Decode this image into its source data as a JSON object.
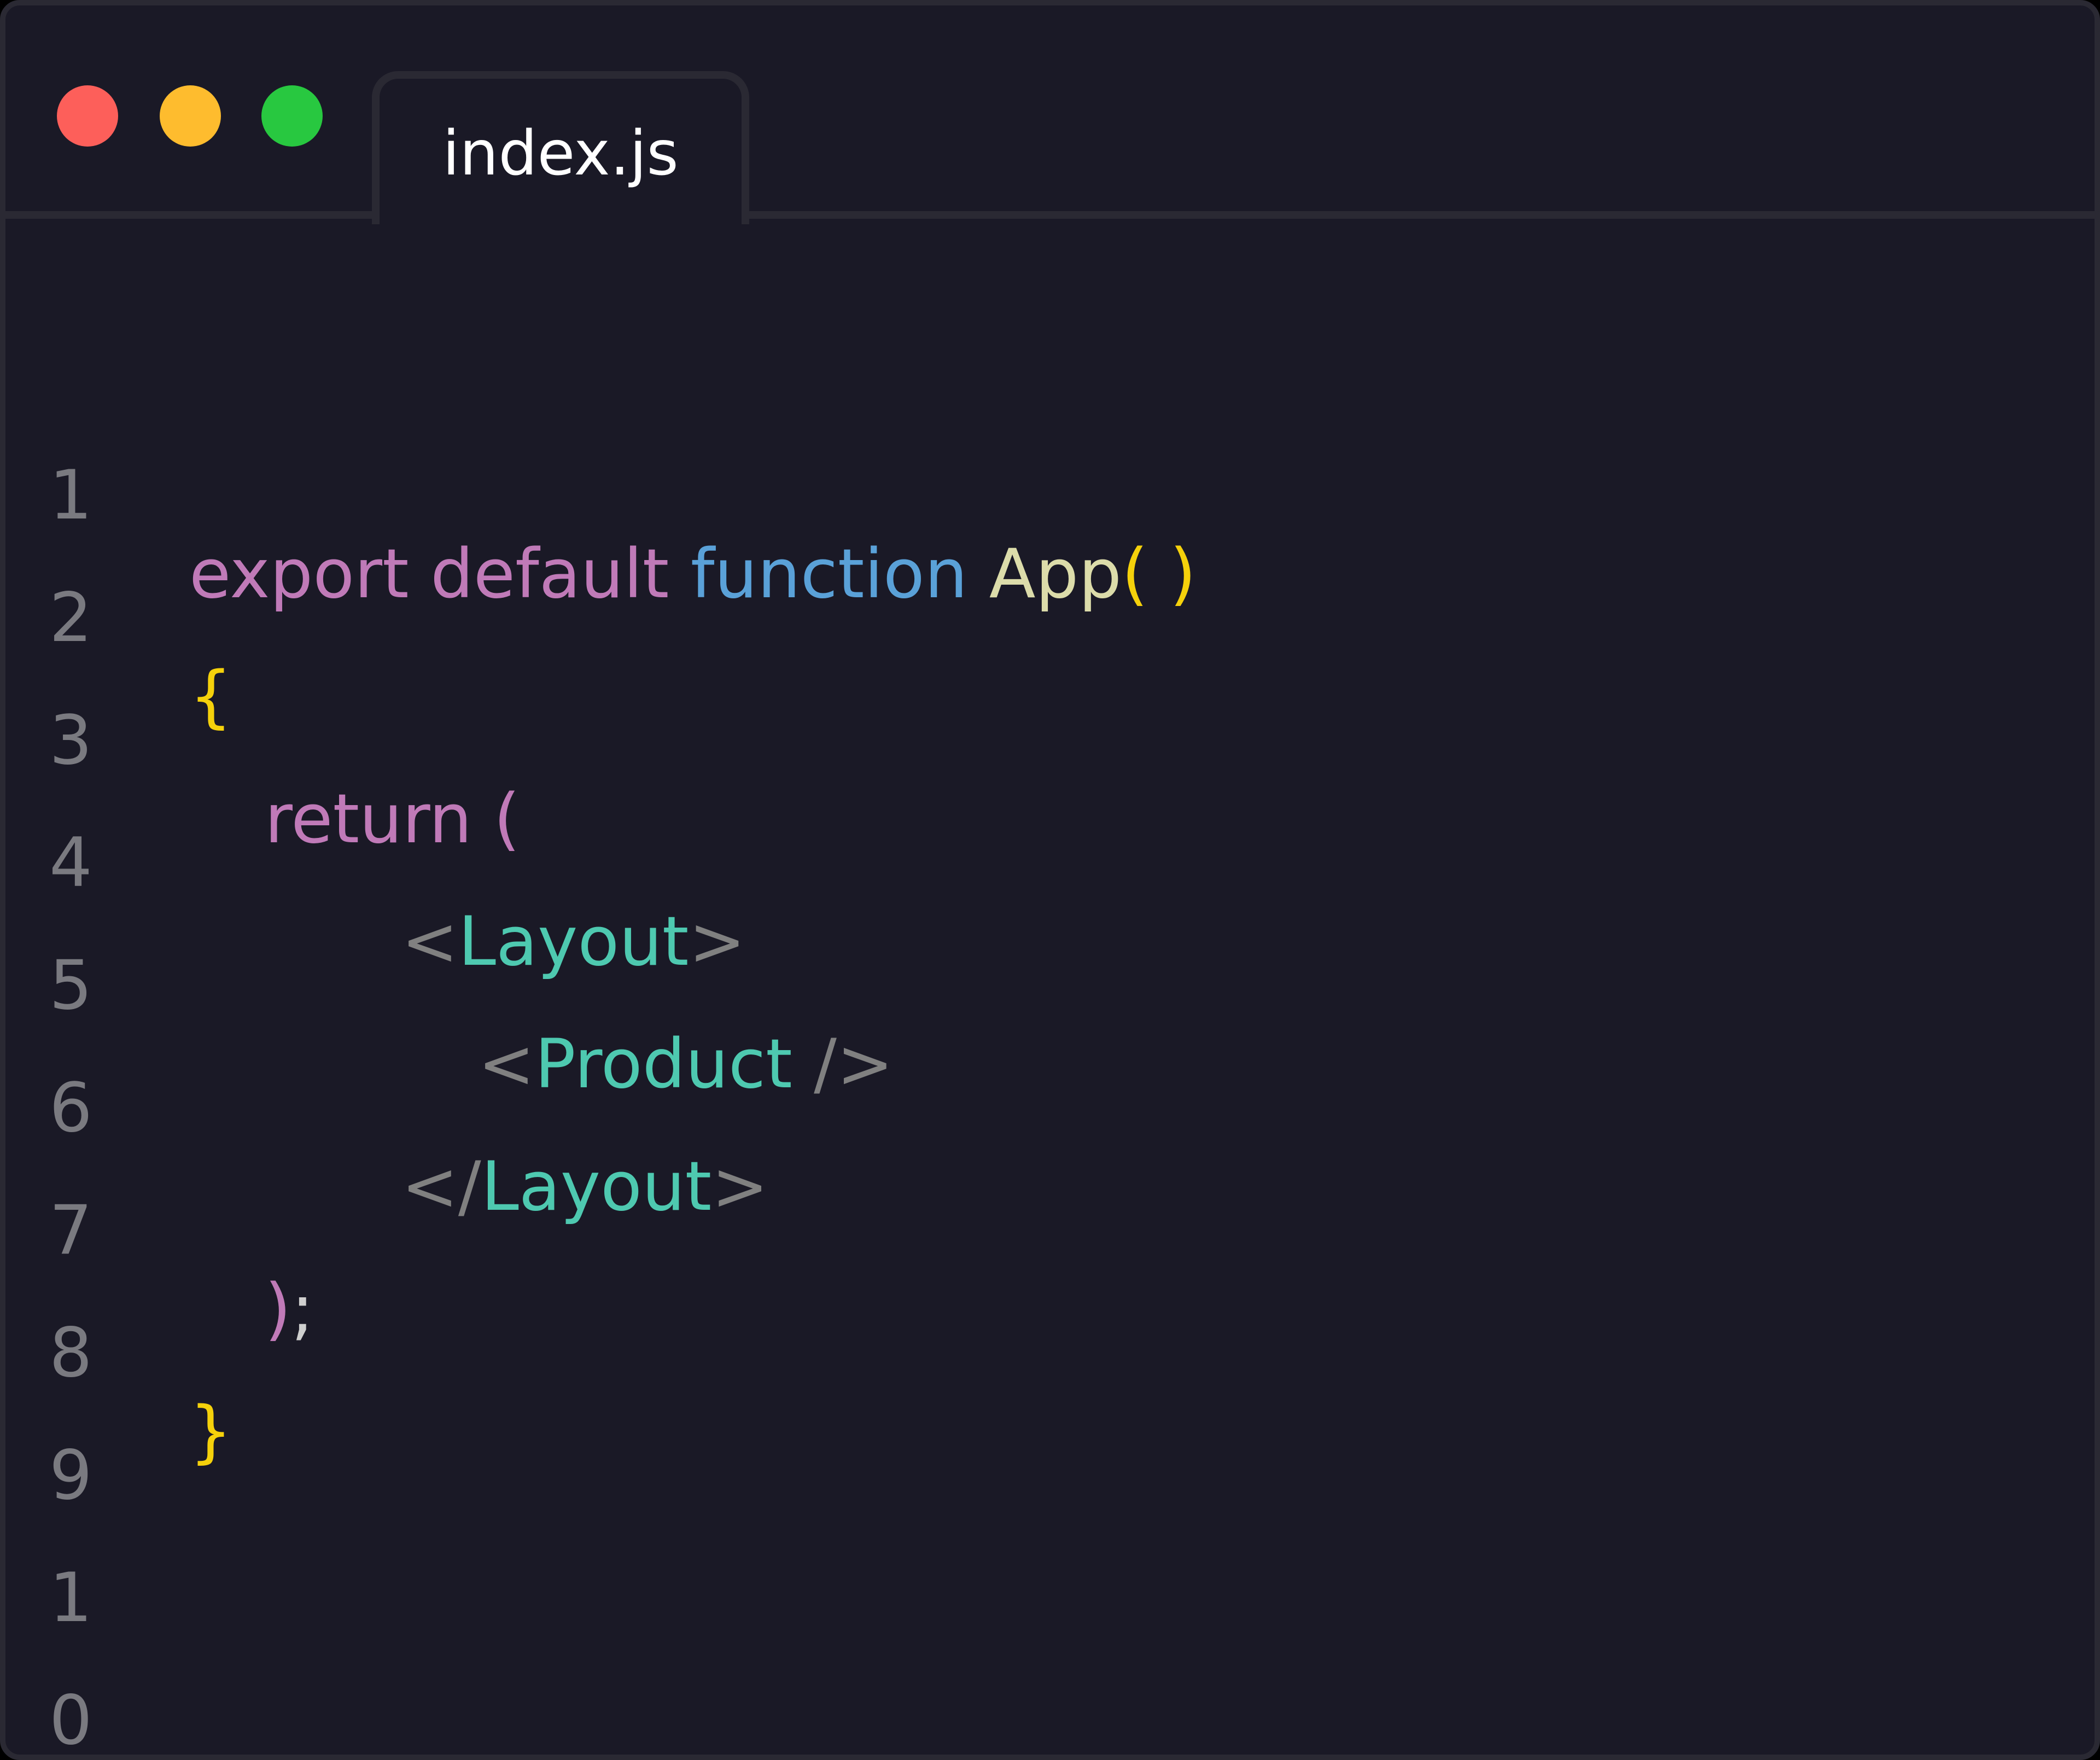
{
  "window": {
    "controls": {
      "close_color": "#fd5f5a",
      "minimize_color": "#febc2e",
      "maximize_color": "#28c840"
    },
    "tab": {
      "label": "index.js"
    }
  },
  "editor": {
    "colors": {
      "keyword": "#c07ab8",
      "function_keyword": "#5aa1d8",
      "function_name": "#dcdcaa",
      "brace": "#f5d10b",
      "tag": "#4ec9b0",
      "tag_bracket": "#808080",
      "line_number": "#7a7a80",
      "background": "#1a1926"
    },
    "lines": [
      {
        "number": "1",
        "tokens": {
          "t1": "export",
          "t2": "default",
          "t3": "function",
          "t4": "App",
          "t5": "( )"
        }
      },
      {
        "number": "2",
        "tokens": {
          "t1": "{"
        }
      },
      {
        "number": "3",
        "tokens": {
          "t1": "return",
          "t2": "("
        }
      },
      {
        "number": "4",
        "tokens": {
          "t1": "<",
          "t2": "Layout",
          "t3": ">"
        }
      },
      {
        "number": "5",
        "tokens": {
          "t1": "<",
          "t2": "Product",
          "t3": " />"
        }
      },
      {
        "number": "6",
        "tokens": {
          "t1": "</",
          "t2": "Layout",
          "t3": ">"
        }
      },
      {
        "number": "7",
        "tokens": {
          "t1": ")",
          "t2": ";"
        }
      },
      {
        "number": "8",
        "tokens": {
          "t1": "}"
        }
      },
      {
        "number": "9",
        "tokens": {}
      },
      {
        "number": "1",
        "tokens": {}
      },
      {
        "number": "0",
        "tokens": {}
      }
    ]
  }
}
